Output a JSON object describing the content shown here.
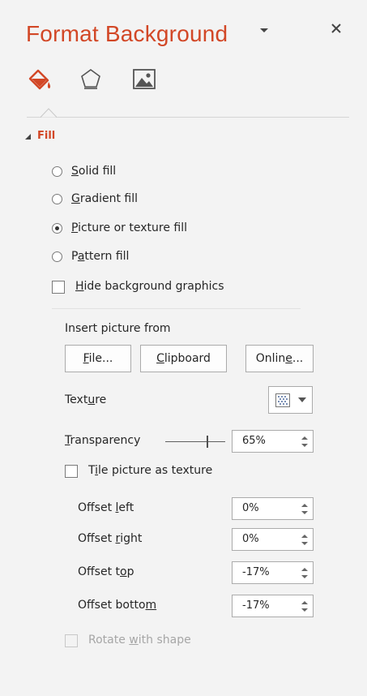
{
  "panel": {
    "title": "Format Background",
    "icons": [
      "fill-bucket-icon",
      "pentagon-effects-icon",
      "picture-icon"
    ]
  },
  "fill_section": {
    "label": "Fill",
    "options": [
      {
        "pre": "",
        "key": "S",
        "post": "olid fill",
        "selected": false
      },
      {
        "pre": "",
        "key": "G",
        "post": "radient fill",
        "selected": false
      },
      {
        "pre": "",
        "key": "P",
        "post": "icture or texture fill",
        "selected": true
      },
      {
        "pre": "P",
        "key": "a",
        "post": "ttern fill",
        "selected": false
      }
    ],
    "hide_bg": {
      "pre": "",
      "key": "H",
      "post": "ide background graphics",
      "checked": false
    }
  },
  "picture": {
    "insert_label": "Insert picture from",
    "file_btn": {
      "pre": "",
      "key": "F",
      "post": "ile..."
    },
    "clipboard_btn": {
      "pre": "",
      "key": "C",
      "post": "lipboard"
    },
    "online_btn": {
      "pre": "Onlin",
      "key": "e",
      "post": "..."
    },
    "texture": {
      "pre": "Text",
      "key": "u",
      "post": "re"
    },
    "transparency": {
      "pre": "",
      "key": "T",
      "post": "ransparency",
      "value": "65%",
      "level": 0.65
    },
    "tile": {
      "pre": "T",
      "key": "i",
      "post": "le picture as texture",
      "checked": false
    },
    "offsets": [
      {
        "pre": "Offset ",
        "key": "l",
        "post": "eft",
        "value": "0%"
      },
      {
        "pre": "Offset ",
        "key": "r",
        "post": "ight",
        "value": "0%"
      },
      {
        "pre": "Offset t",
        "key": "o",
        "post": "p",
        "value": "-17%"
      },
      {
        "pre": "Offset botto",
        "key": "m",
        "post": "",
        "value": "-17%"
      }
    ],
    "rotate": {
      "pre": "Rotate ",
      "key": "w",
      "post": "ith shape",
      "checked": false,
      "enabled": false
    }
  },
  "colors": {
    "accent": "#d24726",
    "background": "#f3f3f3"
  }
}
